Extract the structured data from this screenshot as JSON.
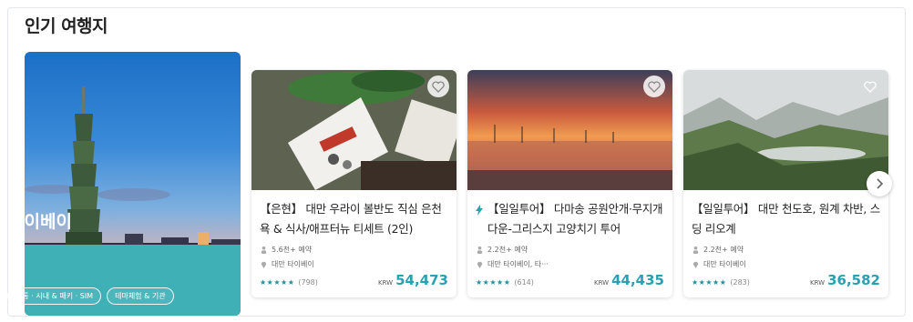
{
  "section": {
    "title": "인기 여행지"
  },
  "featured": {
    "name": "타이베이",
    "chips": [
      "교통 · 시내 & 패키 · SIM",
      "테마체험 & 기관"
    ]
  },
  "cards": [
    {
      "title": "【은현】 대만 우라이 볼반도 직심 은천욕 & 식사/애프터뉴 티세트 (2인)",
      "booked": "5.6천+ 예약",
      "location": "대만 타이베이",
      "stars": "★★★★★",
      "reviews": "(798)",
      "currency": "KRW",
      "price": "54,473"
    },
    {
      "title": "【일일투어】 다마송 공원안개·무지개다운-그리스지 고양치기 투어",
      "booked": "2.2천+ 예약",
      "location": "대만 타이베이, 타···",
      "stars": "★★★★★",
      "reviews": "(614)",
      "currency": "KRW",
      "price": "44,435"
    },
    {
      "title": "【일일투어】 대만 천도호, 원계 차반, 스딩 리오계",
      "booked": "2.2천+ 예약",
      "location": "대만 타이베이",
      "stars": "★★★★★",
      "reviews": "(283)",
      "currency": "KRW",
      "price": "36,582"
    }
  ],
  "icons": {
    "wishlist": "heart-icon",
    "next": "chevron-right-icon",
    "booked": "person-icon",
    "location": "pin-icon",
    "lightning": "lightning-icon"
  },
  "colors": {
    "accent": "#2aa0b2",
    "featured_band": "#3eb0b6"
  }
}
